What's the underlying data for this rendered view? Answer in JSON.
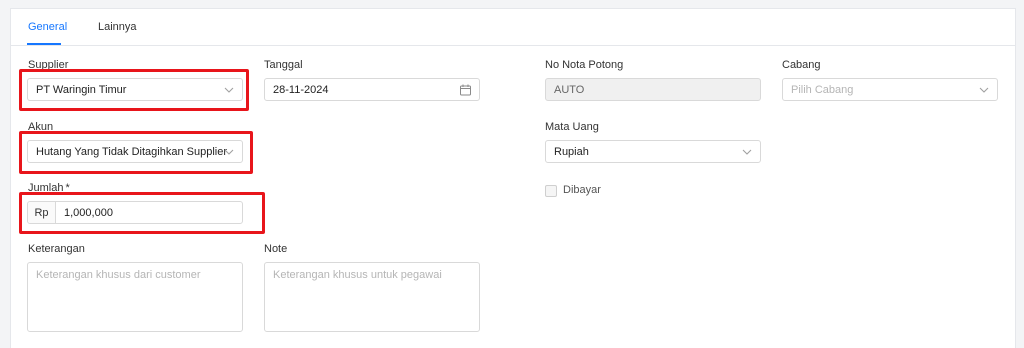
{
  "tabs": [
    {
      "label": "General",
      "active": true
    },
    {
      "label": "Lainnya",
      "active": false
    }
  ],
  "form": {
    "supplier": {
      "label": "Supplier",
      "value": "PT Waringin Timur"
    },
    "tanggal": {
      "label": "Tanggal",
      "value": "28-11-2024"
    },
    "no_nota": {
      "label": "No Nota Potong",
      "value": "AUTO"
    },
    "cabang": {
      "label": "Cabang",
      "placeholder": "Pilih Cabang"
    },
    "akun": {
      "label": "Akun",
      "value": "Hutang Yang Tidak Ditagihkan Supplier"
    },
    "mata_uang": {
      "label": "Mata Uang",
      "value": "Rupiah"
    },
    "jumlah": {
      "label": "Jumlah",
      "required_mark": "*",
      "prefix": "Rp",
      "value": "1,000,000"
    },
    "dibayar": {
      "label": "Dibayar",
      "checked": false
    },
    "keterangan": {
      "label": "Keterangan",
      "placeholder": "Keterangan khusus dari customer"
    },
    "note": {
      "label": "Note",
      "placeholder": "Keterangan khusus untuk pegawai"
    }
  },
  "colors": {
    "accent": "#1677ff",
    "highlight": "#e8151b"
  },
  "icons": {
    "select": "chevron-down-icon",
    "date": "calendar-icon"
  }
}
